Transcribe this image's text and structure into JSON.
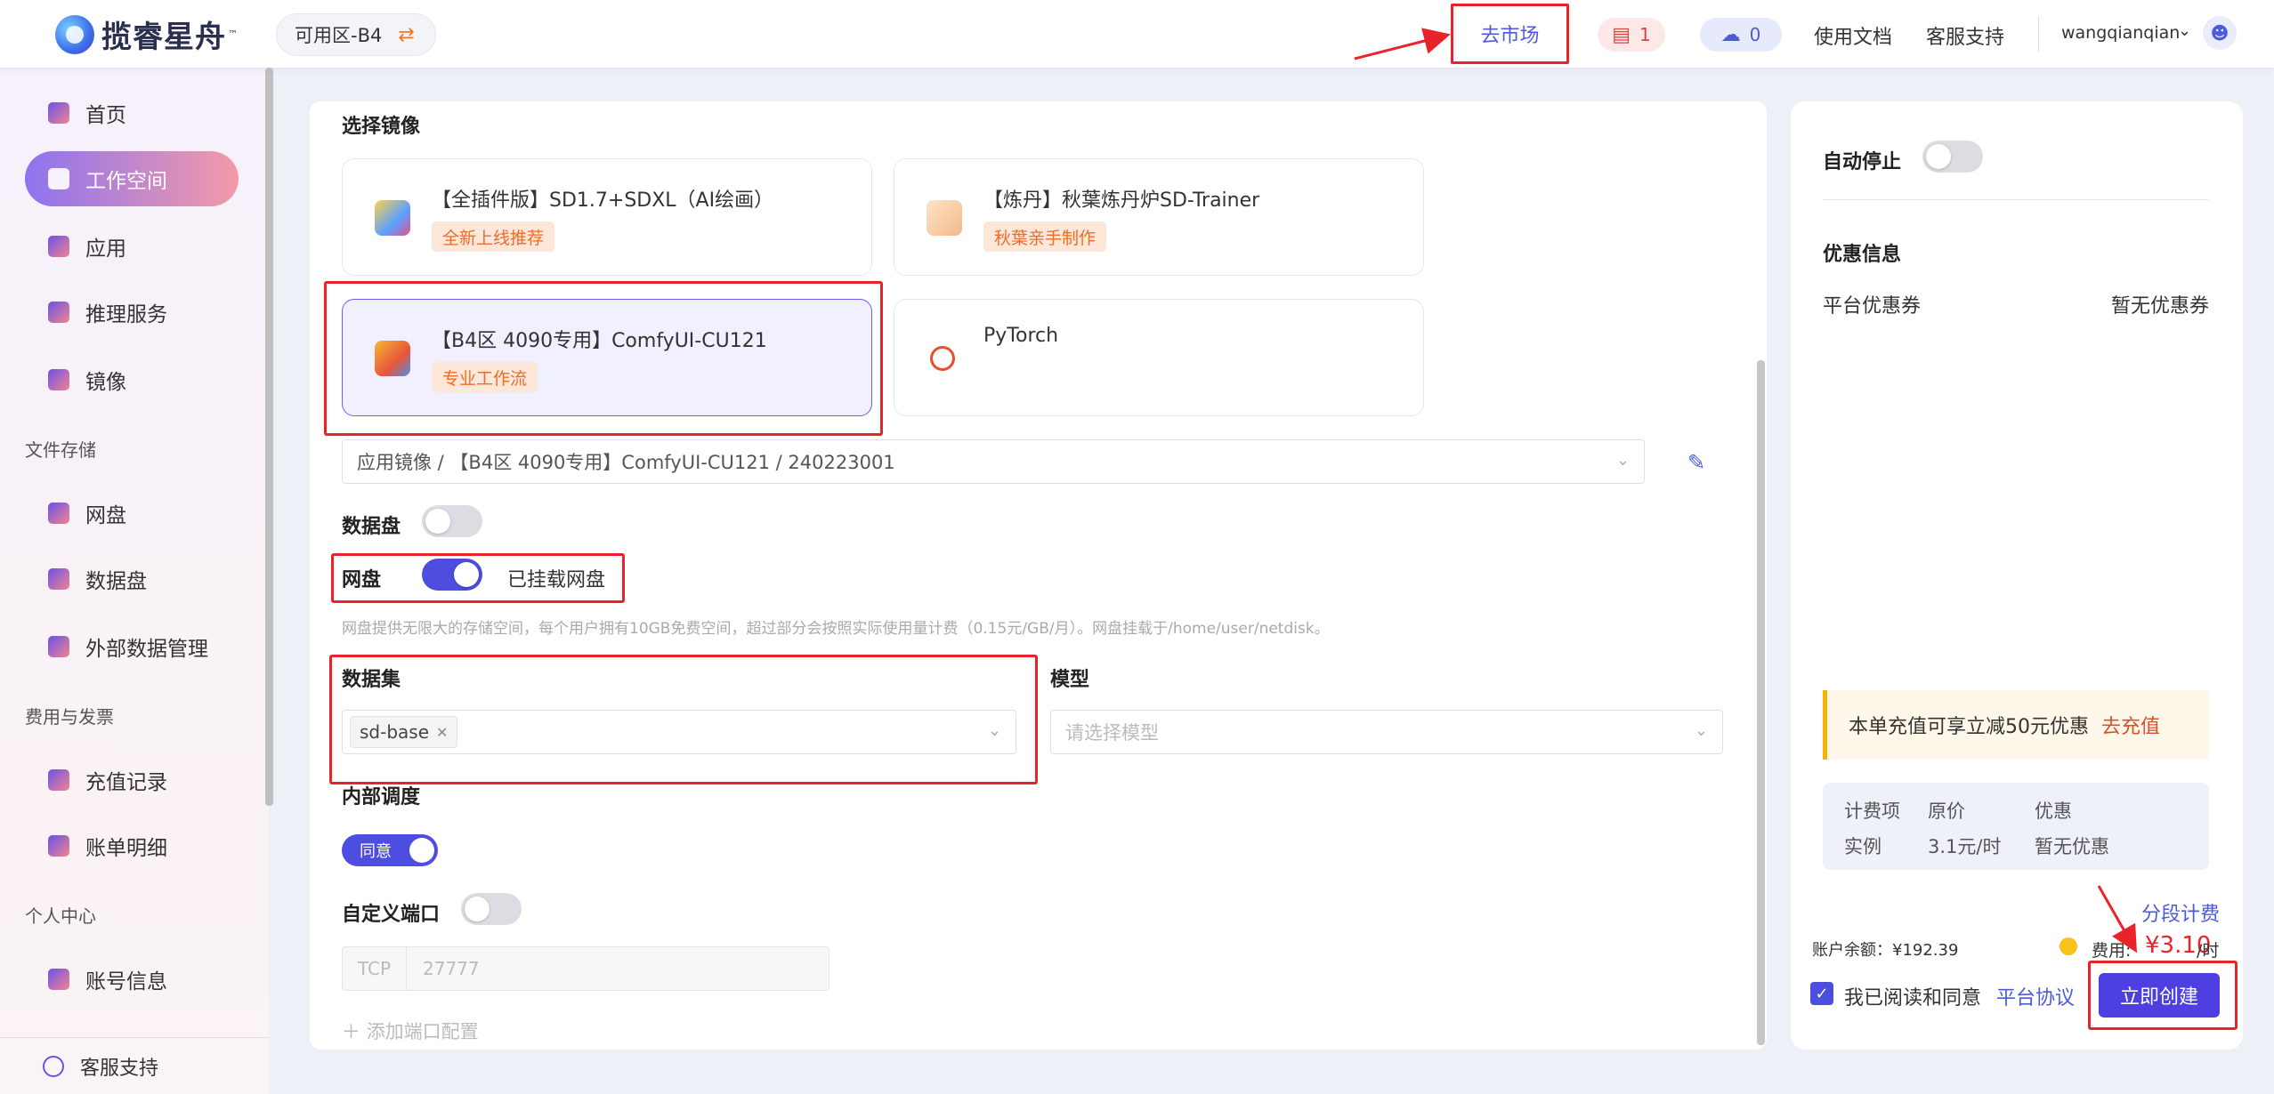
{
  "header": {
    "brand": "揽睿星舟",
    "brand_tm": "™",
    "zone": "可用区-B4",
    "market_label": "去市场",
    "notice_count": "1",
    "upload_count": "0",
    "docs_label": "使用文档",
    "support_label": "客服支持",
    "username": "wangqianqian"
  },
  "sidebar": {
    "items": [
      {
        "label": "首页"
      },
      {
        "label": "工作空间"
      },
      {
        "label": "应用"
      },
      {
        "label": "推理服务"
      },
      {
        "label": "镜像"
      }
    ],
    "group_storage": "文件存储",
    "storage_items": [
      {
        "label": "网盘"
      },
      {
        "label": "数据盘"
      },
      {
        "label": "外部数据管理"
      }
    ],
    "group_billing": "费用与发票",
    "billing_items": [
      {
        "label": "充值记录"
      },
      {
        "label": "账单明细"
      }
    ],
    "group_personal": "个人中心",
    "personal_items": [
      {
        "label": "账号信息"
      }
    ],
    "bottom_support": "客服支持"
  },
  "form": {
    "select_image_label": "选择镜像",
    "images": [
      {
        "title": "【全插件版】SD1.7+SDXL（AI绘画）",
        "tag": "全新上线推荐"
      },
      {
        "title": "【炼丹】秋葉炼丹炉SD-Trainer",
        "tag": "秋葉亲手制作"
      },
      {
        "title": "【B4区 4090专用】ComfyUI-CU121",
        "tag": "专业工作流"
      },
      {
        "title": "PyTorch",
        "tag": ""
      }
    ],
    "image_path": "应用镜像 / 【B4区 4090专用】ComfyUI-CU121  / 240223001",
    "data_disk_label": "数据盘",
    "netdisk_label": "网盘",
    "netdisk_status": "已挂载网盘",
    "netdisk_hint": "网盘提供无限大的存储空间，每个用户拥有10GB免费空间，超过部分会按照实际使用量计费（0.15元/GB/月）。网盘挂载于/home/user/netdisk。",
    "dataset_label": "数据集",
    "dataset_chip": "sd-base",
    "model_label": "模型",
    "model_placeholder": "请选择模型",
    "internal_label": "内部调度",
    "agree_label": "同意",
    "custom_port_label": "自定义端口",
    "port_prefix": "TCP",
    "port_placeholder": "27777",
    "add_port_label": "添加端口配置"
  },
  "panel": {
    "auto_stop_label": "自动停止",
    "discount_title": "优惠信息",
    "coupon_label": "平台优惠券",
    "coupon_value": "暂无优惠券",
    "promo_text": "本单充值可享立减50元优惠",
    "promo_link": "去充值",
    "bill_headers": [
      "计费项",
      "原价",
      "优惠"
    ],
    "bill_row": [
      "实例",
      "3.1元/时",
      "暂无优惠"
    ],
    "segment_billing": "分段计费",
    "balance": "账户余额：¥192.39",
    "fee_label": "费用:",
    "fee_value": "¥3.10",
    "fee_unit": "/时",
    "agree_text": "我已阅读和同意",
    "agreement_link": "平台协议",
    "create_label": "立即创建"
  }
}
